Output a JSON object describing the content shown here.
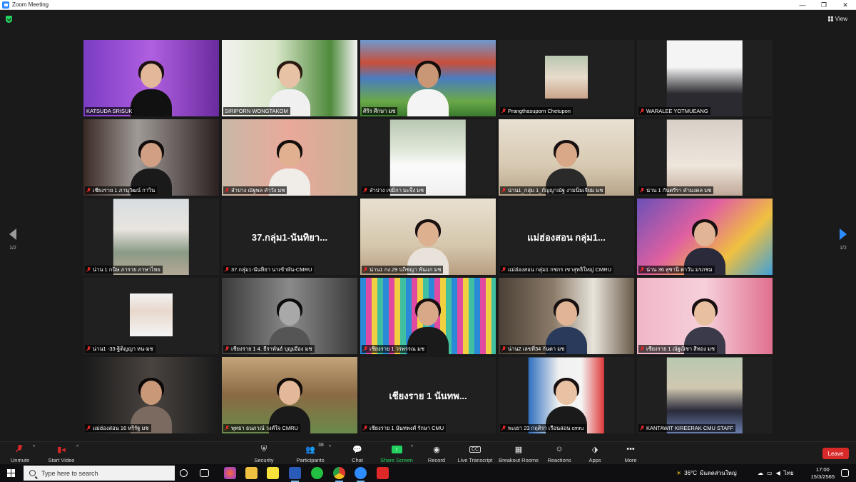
{
  "window": {
    "title": "Zoom Meeting",
    "controls": {
      "minimize": "—",
      "maximize": "❐",
      "close": "✕"
    }
  },
  "meeting": {
    "view_label": "View",
    "page_left": "1/2",
    "page_right": "1/2",
    "tiles": [
      {
        "name": "KATSUDA SRISUK",
        "muted": false,
        "center": ""
      },
      {
        "name": "SIRIPORN WONGTAKOM",
        "muted": false,
        "center": ""
      },
      {
        "name": "ศิริร ศึกษา มช",
        "muted": false,
        "center": "",
        "active": true
      },
      {
        "name": "Prangthasuporn Chetupon",
        "muted": true,
        "center": ""
      },
      {
        "name": "WARALEE YOTMUEANG",
        "muted": true,
        "center": ""
      },
      {
        "name": "เชียงราย 1 ภานุวัฒน์ กาวิน",
        "muted": true,
        "center": ""
      },
      {
        "name": "ลำปาง ณัฐพล คำวัง มช",
        "muted": true,
        "center": ""
      },
      {
        "name": "ลำปาง เขมิกา มะจึง มช",
        "muted": true,
        "center": ""
      },
      {
        "name": "น่าน1_กลุ่ม 1_กัญญาณัฐ งามนิ่มเจียม มช",
        "muted": true,
        "center": ""
      },
      {
        "name": "น่าน 1 กันตรีรา คำมงคล มช",
        "muted": true,
        "center": ""
      },
      {
        "name": "น่าน 1 กนิษ ภาราย ภาษาไทย",
        "muted": true,
        "center": ""
      },
      {
        "name": "37.กลุ่ม1-นันทิยา นาเข้าพัน-CMRU",
        "muted": true,
        "center": "37.กลุ่ม1-นันทิยา..."
      },
      {
        "name": "น่าน1 กง.29 ปภิชญา พันแก มช",
        "muted": true,
        "center": ""
      },
      {
        "name": "แม่ฮ่องสอน กลุ่ม1 กชกร เขาสุทธิใหญ่ CMRU",
        "muted": true,
        "center": "แม่ฮ่องสอน กลุ่ม1..."
      },
      {
        "name": "น่าน 36 สุชานิ ตาวัน มรภชม",
        "muted": true,
        "center": ""
      },
      {
        "name": "น่าน1 -33-ฐิติญญา หน-มช",
        "muted": true,
        "center": ""
      },
      {
        "name": "เชียงราย 1 4. ธีราพันธ์ บุญเมือง มช",
        "muted": true,
        "center": ""
      },
      {
        "name": "เชียงราย 1 วรพรรณ มช",
        "muted": true,
        "center": ""
      },
      {
        "name": "น่าน2 เลขที่34 กันตา มช",
        "muted": true,
        "center": ""
      },
      {
        "name": "เชียงราย 1 ณัฐณิชา สีทอง มช",
        "muted": true,
        "center": ""
      },
      {
        "name": "แม่ฮ่องสอน 16 หริรัฐ มช",
        "muted": true,
        "center": ""
      },
      {
        "name": "พุทธา ธนภาณ์ วงศ์ใจ CMRU",
        "muted": true,
        "center": ""
      },
      {
        "name": "เชียงราย 1 นันทพงศ์ รักษา CMU",
        "muted": true,
        "center": "เชียงราย 1 นันทพ..."
      },
      {
        "name": "พะเยา 23 กฤติรา เรือนสอน cmru",
        "muted": true,
        "center": ""
      },
      {
        "name": "KANTAWIT KIREERAK CMU STAFF",
        "muted": true,
        "center": ""
      }
    ]
  },
  "toolbar": {
    "unmute": "Unmute",
    "start_video": "Start Video",
    "security": "Security",
    "participants": "Participants",
    "participants_count": "38",
    "chat": "Chat",
    "share_screen": "Share Screen",
    "record": "Record",
    "live_transcript": "Live Transcript",
    "breakout_rooms": "Breakout Rooms",
    "reactions": "Reactions",
    "apps": "Apps",
    "more": "More",
    "leave": "Leave",
    "cc_badge": "CC"
  },
  "taskbar": {
    "search_placeholder": "Type here to search",
    "weather": "36°C",
    "weather_text": "มีแดดส่วนใหญ่",
    "lang": "ไทย",
    "time": "17:00",
    "date": "15/3/2565"
  }
}
